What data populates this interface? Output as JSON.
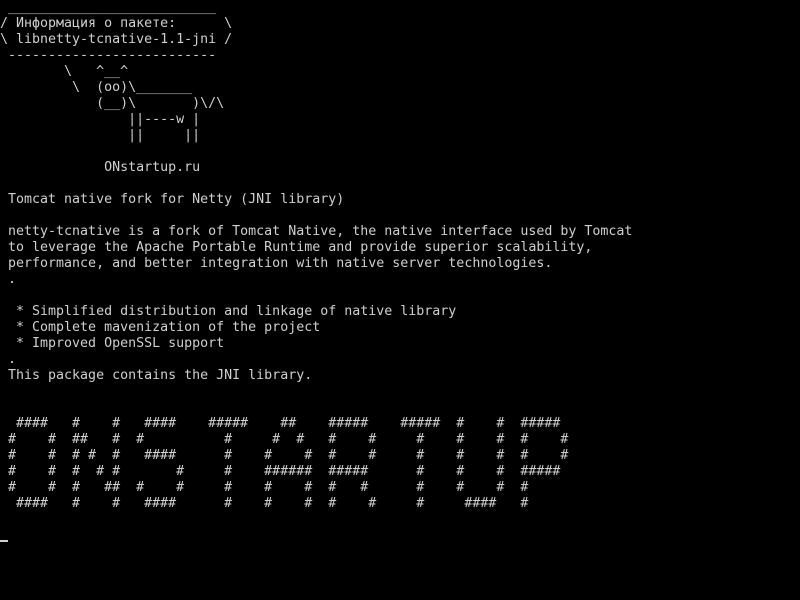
{
  "terminal": {
    "cowsay": [
      " __________________________",
      "/ Информация о пакете:      \\",
      "\\ libnetty-tcnative-1.1-jni /",
      " --------------------------",
      "        \\   ^__^",
      "         \\  (oo)\\_______",
      "            (__)\\       )\\/\\",
      "                ||----w |",
      "                ||     ||",
      "",
      "             ONstartup.ru"
    ],
    "summary": " Tomcat native fork for Netty (JNI library)",
    "description": [
      " netty-tcnative is a fork of Tomcat Native, the native interface used by Tomcat",
      " to leverage the Apache Portable Runtime and provide superior scalability,",
      " performance, and better integration with native server technologies.",
      " ."
    ],
    "features": [
      "  * Simplified distribution and linkage of native library",
      "  * Complete mavenization of the project",
      "  * Improved OpenSSL support",
      " ."
    ],
    "footer": " This package contains the JNI library.",
    "banner": [
      "  ####   #    #   ####    #####    ##    #####    #####  #    #  #####",
      " #    #  ##   #  #          #     #  #   #    #     #    #    #  #    #",
      " #    #  # #  #   ####      #    #    #  #    #     #    #    #  #    #",
      " #    #  #  # #       #     #    ######  #####      #    #    #  #####",
      " #    #  #   ##  #    #     #    #    #  #   #      #    #    #  #",
      "  ####   #    #   ####      #    #    #  #    #     #     ####   #"
    ]
  }
}
